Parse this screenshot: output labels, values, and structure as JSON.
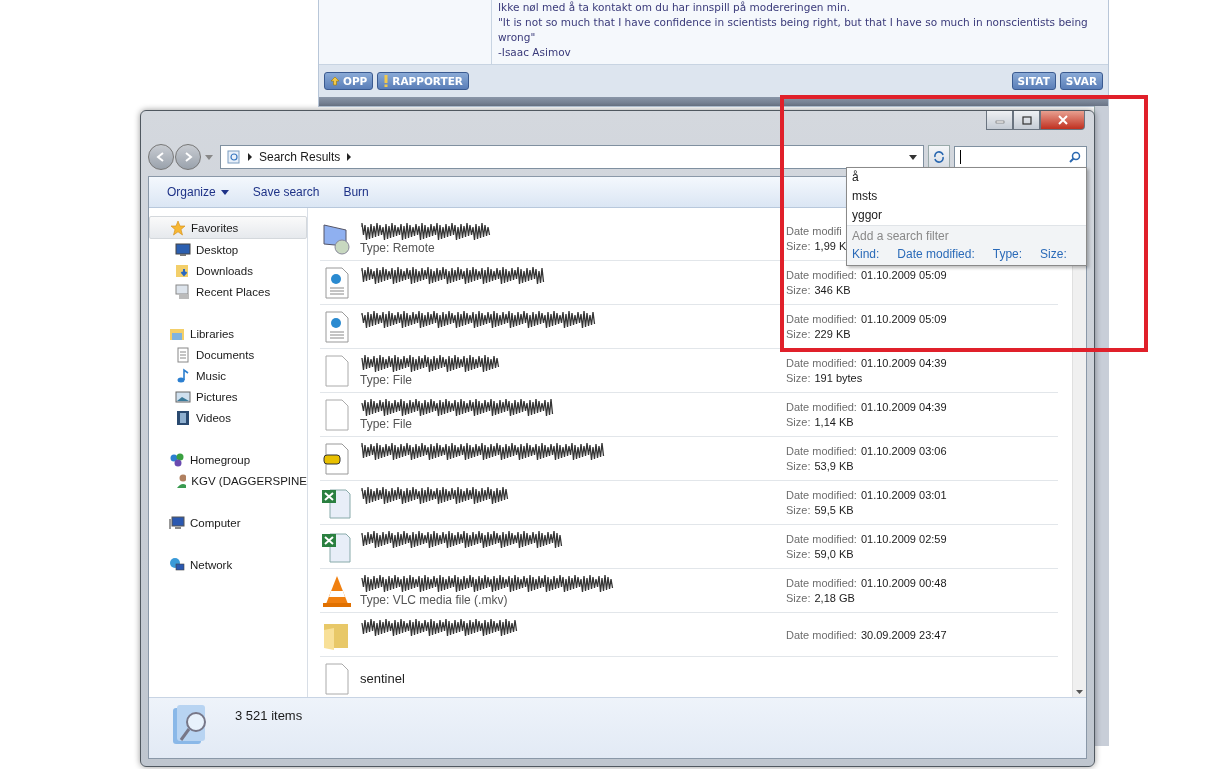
{
  "forum_post": {
    "signature_lines": [
      "Ikke nøl med å ta kontakt om du har innspill på modereringen min.",
      "\"It is not so much that I have confidence in scientists being right, but that I have so much in nonscientists being wrong\"",
      "-Isaac Asimov"
    ],
    "left_buttons": [
      {
        "label": "OPP",
        "kind": "up"
      },
      {
        "label": "RAPPORTER",
        "kind": "alert"
      }
    ],
    "right_buttons": [
      {
        "label": "SITAT"
      },
      {
        "label": "SVAR"
      }
    ]
  },
  "explorer": {
    "address": {
      "crumb": "Search Results"
    },
    "search_suggestions": [
      "å",
      "msts",
      "yggor"
    ],
    "filter_hint": "Add a search filter",
    "filters": [
      "Kind:",
      "Date modified:",
      "Type:",
      "Size:"
    ],
    "toolbar": [
      {
        "label": "Organize",
        "has_menu": true
      },
      {
        "label": "Save search",
        "has_menu": false
      },
      {
        "label": "Burn",
        "has_menu": false
      }
    ],
    "nav": [
      {
        "label": "Favorites",
        "kind": "star",
        "selected": true,
        "children": [
          {
            "label": "Desktop",
            "kind": "desktop",
            "selected": false
          },
          {
            "label": "Downloads",
            "kind": "downloads",
            "selected": false
          },
          {
            "label": "Recent Places",
            "kind": "recent",
            "selected": false
          }
        ]
      },
      {
        "label": "Libraries",
        "kind": "library",
        "selected": false,
        "children": [
          {
            "label": "Documents",
            "kind": "document",
            "selected": false
          },
          {
            "label": "Music",
            "kind": "music",
            "selected": false
          },
          {
            "label": "Pictures",
            "kind": "pictures",
            "selected": false
          },
          {
            "label": "Videos",
            "kind": "videos",
            "selected": false
          }
        ]
      },
      {
        "label": "Homegroup",
        "kind": "homegroup",
        "selected": false,
        "children": [
          {
            "label": "KGV (DAGGERSPINE",
            "kind": "user",
            "selected": false
          }
        ]
      },
      {
        "label": "Computer",
        "kind": "computer",
        "selected": false
      },
      {
        "label": "Network",
        "kind": "network",
        "selected": false
      }
    ],
    "files": [
      {
        "kind": "remote",
        "detail": "Type: Remote",
        "date_label": "Date modifi",
        "size_label": "Size:",
        "size": "1,99 K"
      },
      {
        "kind": "web",
        "date_label": "Date modified:",
        "date": "01.10.2009 05:09",
        "size_label": "Size:",
        "size": "346 KB"
      },
      {
        "kind": "web",
        "date_label": "Date modified:",
        "date": "01.10.2009 05:09",
        "size_label": "Size:",
        "size": "229 KB"
      },
      {
        "kind": "blank",
        "detail": "Type: File",
        "date_label": "Date modified:",
        "date": "01.10.2009 04:39",
        "size_label": "Size:",
        "size": "191 bytes"
      },
      {
        "kind": "blank",
        "detail": "Type: File",
        "date_label": "Date modified:",
        "date": "01.10.2009 04:39",
        "size_label": "Size:",
        "size": "1,14 KB"
      },
      {
        "kind": "pdf",
        "date_label": "Date modified:",
        "date": "01.10.2009 03:06",
        "size_label": "Size:",
        "size": "53,9 KB"
      },
      {
        "kind": "excel",
        "date_label": "Date modified:",
        "date": "01.10.2009 03:01",
        "size_label": "Size:",
        "size": "59,5 KB"
      },
      {
        "kind": "excel",
        "date_label": "Date modified:",
        "date": "01.10.2009 02:59",
        "size_label": "Size:",
        "size": "59,0 KB"
      },
      {
        "kind": "vlc",
        "detail": "Type: VLC media file (.mkv)",
        "date_label": "Date modified:",
        "date": "01.10.2009 00:48",
        "size_label": "Size:",
        "size": "2,18 GB"
      },
      {
        "kind": "folder",
        "date_label": "Date modified:",
        "date": "30.09.2009 23:47"
      },
      {
        "kind": "blank",
        "name": "sentinel"
      }
    ],
    "status": {
      "count": "3 521 items"
    }
  }
}
